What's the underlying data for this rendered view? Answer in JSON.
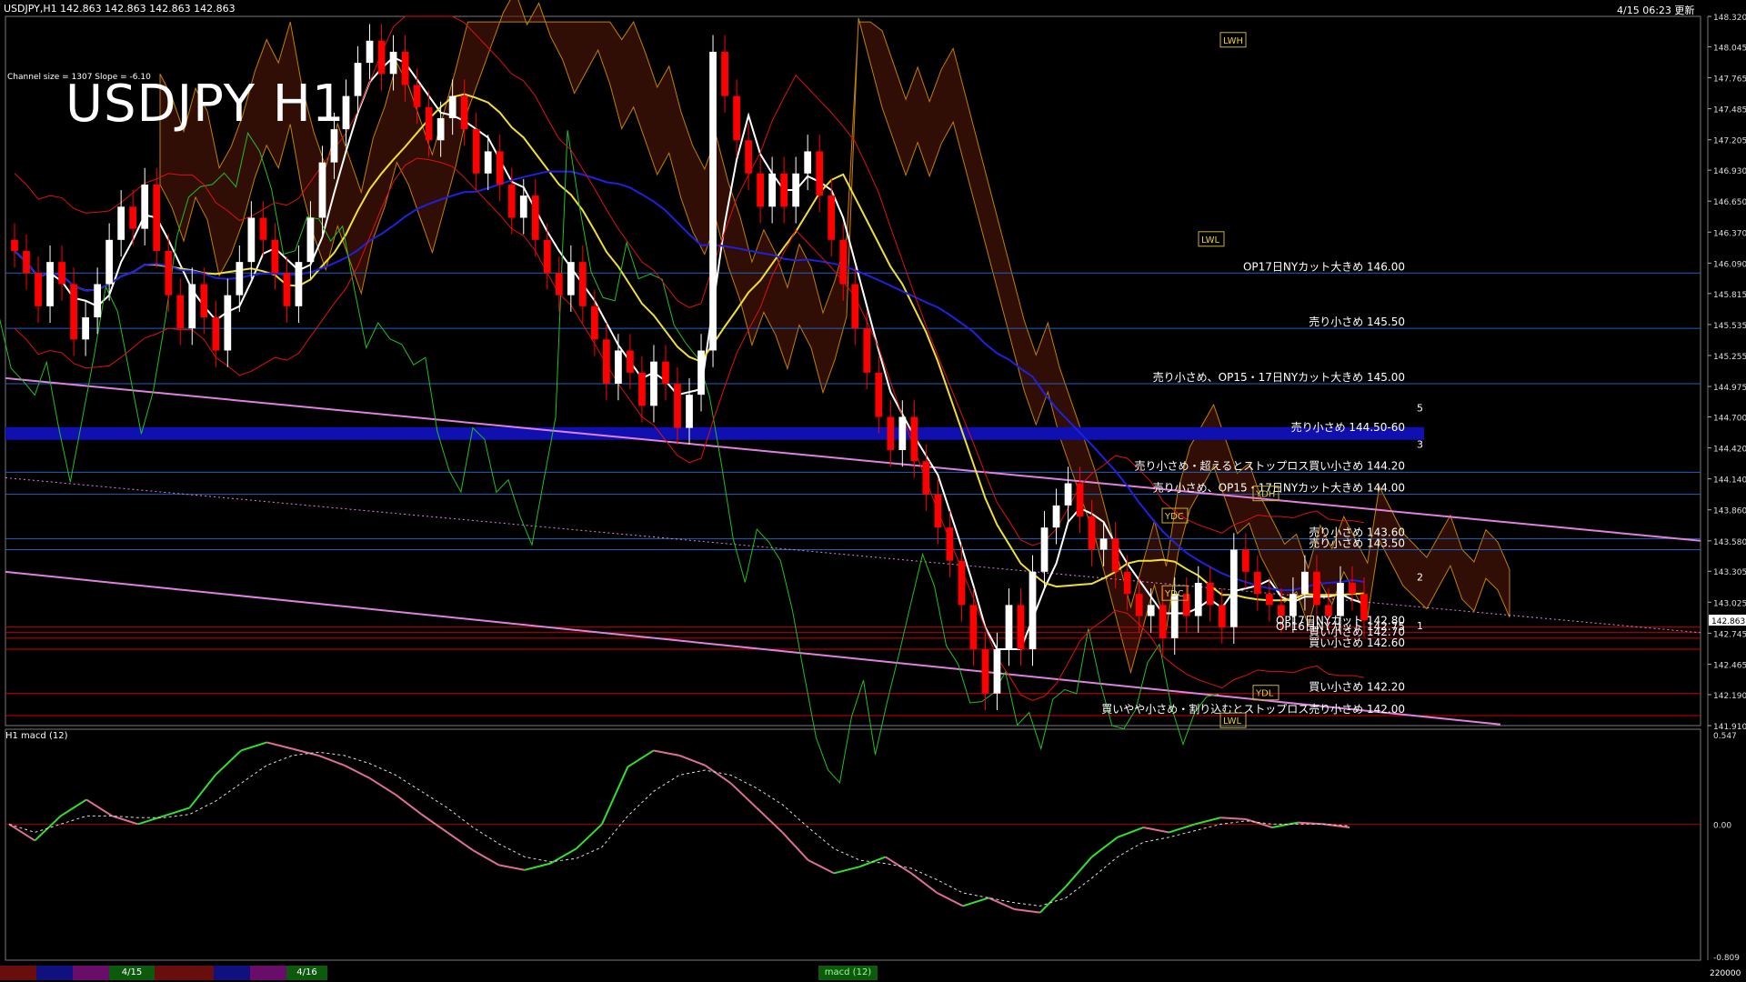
{
  "header": {
    "symbol_info": "USDJPY,H1  142.863 142.863 142.863 142.863",
    "timestamp": "4/15 06:23 更新",
    "channel_info": "Channel size = 1307  Slope = -6.10",
    "big_title": "USDJPY H1"
  },
  "colors": {
    "background": "#000000",
    "bull": "#ffffff",
    "bear": "#ff0000",
    "ma_white": "#ffffff",
    "ma_yellow": "#f0e030",
    "ma_blue": "#2020e0",
    "lagging_green": "#20c020",
    "bollinger": "#e01010",
    "cloud_orange": "#c08000",
    "trend_pink": "#e080e0",
    "level_blue": "#2060c0",
    "level_red": "#d00000",
    "macd_green": "#30e030",
    "macd_pink": "#e07090"
  },
  "chart_data": {
    "type": "candlestick",
    "symbol": "USDJPY",
    "timeframe": "H1",
    "price_axis": {
      "ylim": [
        141.91,
        148.32
      ],
      "ticks": [
        "148.320",
        "148.045",
        "147.765",
        "147.485",
        "147.205",
        "146.930",
        "146.650",
        "146.370",
        "146.090",
        "145.815",
        "145.535",
        "145.255",
        "144.975",
        "144.700",
        "144.420",
        "144.140",
        "143.860",
        "143.580",
        "143.305",
        "143.025",
        "142.745",
        "142.465",
        "142.190",
        "141.910"
      ],
      "current_price": "142.863"
    },
    "closes": [
      146.2,
      146.0,
      145.7,
      146.1,
      145.9,
      145.4,
      145.6,
      145.9,
      146.3,
      146.6,
      146.4,
      146.8,
      146.2,
      145.8,
      145.5,
      145.9,
      145.6,
      145.3,
      145.8,
      146.1,
      146.5,
      146.3,
      146.0,
      145.7,
      146.1,
      146.5,
      147.0,
      147.3,
      147.6,
      147.9,
      148.1,
      147.8,
      148.0,
      147.7,
      147.5,
      147.2,
      147.4,
      147.6,
      147.3,
      146.9,
      147.1,
      146.8,
      146.5,
      146.7,
      146.3,
      146.0,
      145.8,
      146.1,
      145.7,
      145.4,
      145.0,
      145.3,
      145.1,
      144.8,
      145.2,
      145.0,
      144.6,
      144.9,
      145.3,
      148.0,
      147.6,
      147.2,
      146.9,
      146.6,
      146.9,
      146.6,
      146.9,
      147.1,
      146.7,
      146.3,
      145.9,
      145.5,
      145.1,
      144.7,
      144.4,
      144.7,
      144.3,
      144.0,
      143.7,
      143.4,
      143.0,
      142.6,
      142.2,
      142.6,
      143.0,
      142.6,
      143.3,
      143.7,
      143.9,
      144.1,
      143.8,
      143.5,
      143.6,
      143.3,
      143.1,
      142.9,
      143.0,
      142.7,
      143.1,
      142.9,
      143.2,
      143.0,
      142.8,
      143.5,
      143.3,
      143.1,
      143.0,
      142.9,
      143.1,
      143.3,
      143.0,
      142.9,
      143.2,
      143.1,
      142.86
    ],
    "levels": [
      {
        "price": 146.0,
        "label": "OP17日NYカット大きめ 146.00",
        "kind": "resistance"
      },
      {
        "price": 145.5,
        "label": "売り小さめ 145.50",
        "kind": "resistance"
      },
      {
        "price": 145.0,
        "label": "売り小さめ、OP15・17日NYカット大きめ 145.00",
        "kind": "resistance"
      },
      {
        "price": 144.55,
        "label": "売り小さめ 144.50-60",
        "kind": "zone"
      },
      {
        "price": 144.2,
        "label": "売り小さめ・超えるとストップロス買い小さめ 144.20",
        "kind": "resistance"
      },
      {
        "price": 144.0,
        "label": "売り小さめ、OP15・17日NYカット大きめ 144.00",
        "kind": "resistance"
      },
      {
        "price": 143.6,
        "label": "売り小さめ 143.60",
        "kind": "resistance"
      },
      {
        "price": 143.5,
        "label": "売り小さめ 143.50",
        "kind": "resistance"
      },
      {
        "price": 142.8,
        "label": "OP17日NYカット 142.80",
        "kind": "support"
      },
      {
        "price": 142.75,
        "label": "OP16日NYカット 142.75",
        "kind": "support"
      },
      {
        "price": 142.7,
        "label": "買い小さめ 142.70",
        "kind": "support"
      },
      {
        "price": 142.6,
        "label": "買い小さめ 142.60",
        "kind": "support"
      },
      {
        "price": 142.2,
        "label": "買い小さめ 142.20",
        "kind": "support"
      },
      {
        "price": 142.0,
        "label": "買いやや小さめ・割り込むとストップロス売り小さめ 142.00",
        "kind": "support"
      }
    ],
    "markers": [
      "YDH",
      "YDC",
      "YDC",
      "YDL",
      "LWH",
      "LWL",
      "LWL"
    ],
    "scenario_labels": [
      "5",
      "3",
      "2",
      "1"
    ],
    "macd": {
      "title": "H1  macd (12)",
      "ylim": [
        -0.809,
        0.547
      ],
      "ticks": [
        "0.547",
        "0.00",
        "-0.809"
      ],
      "main": [
        0.0,
        -0.1,
        0.05,
        0.15,
        0.05,
        0.0,
        0.05,
        0.1,
        0.3,
        0.45,
        0.5,
        0.46,
        0.42,
        0.36,
        0.28,
        0.18,
        0.06,
        -0.05,
        -0.16,
        -0.25,
        -0.28,
        -0.24,
        -0.15,
        0.0,
        0.35,
        0.45,
        0.42,
        0.36,
        0.25,
        0.1,
        -0.05,
        -0.22,
        -0.3,
        -0.26,
        -0.2,
        -0.3,
        -0.42,
        -0.5,
        -0.45,
        -0.52,
        -0.54,
        -0.38,
        -0.2,
        -0.08,
        -0.02,
        -0.05,
        0.0,
        0.04,
        0.03,
        -0.02,
        0.01,
        0.0,
        -0.02
      ],
      "signal": [
        0.0,
        -0.05,
        0.0,
        0.05,
        0.05,
        0.04,
        0.04,
        0.06,
        0.14,
        0.25,
        0.36,
        0.42,
        0.44,
        0.42,
        0.37,
        0.3,
        0.2,
        0.1,
        -0.02,
        -0.12,
        -0.2,
        -0.23,
        -0.21,
        -0.14,
        0.05,
        0.2,
        0.3,
        0.33,
        0.3,
        0.22,
        0.12,
        -0.02,
        -0.15,
        -0.22,
        -0.24,
        -0.27,
        -0.34,
        -0.42,
        -0.45,
        -0.48,
        -0.5,
        -0.45,
        -0.33,
        -0.2,
        -0.11,
        -0.08,
        -0.04,
        0.0,
        0.02,
        0.0,
        0.0,
        0.0,
        -0.01
      ]
    },
    "bottom_tabs": [
      "4/15",
      "4/16",
      "macd (12)"
    ],
    "volume_tick": "220000"
  }
}
